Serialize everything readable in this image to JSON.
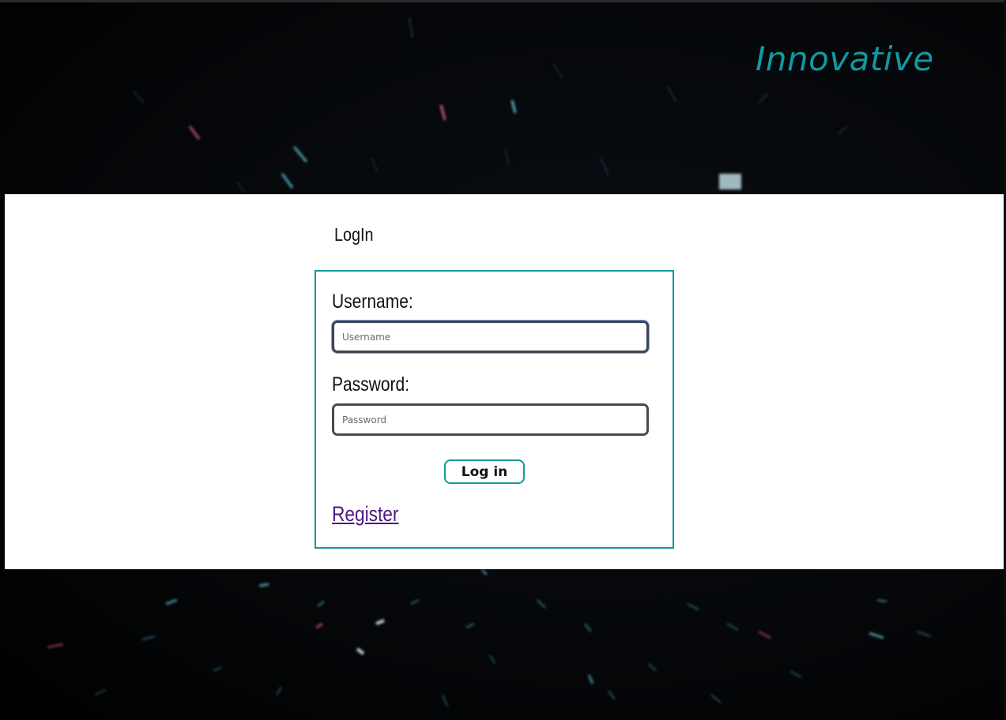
{
  "brand": {
    "name": "Innovative",
    "color": "#0f9aa0"
  },
  "login": {
    "title": "LogIn",
    "username": {
      "label": "Username:",
      "placeholder": "Username",
      "value": ""
    },
    "password": {
      "label": "Password:",
      "placeholder": "Password",
      "value": ""
    },
    "submit_label": "Log in",
    "register_label": "Register"
  },
  "theme": {
    "accent": "#15979b",
    "link": "#4b1a7d",
    "panel_background": "#ffffff",
    "page_background": "#000000"
  }
}
